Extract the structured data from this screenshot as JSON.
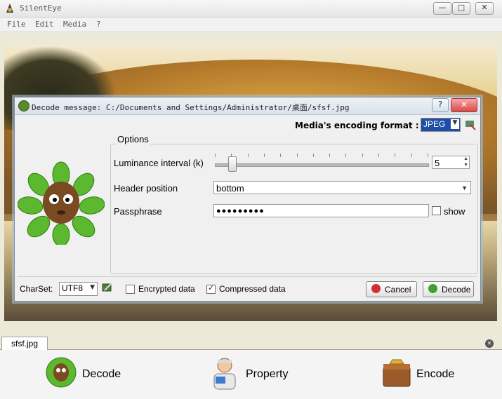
{
  "window": {
    "title": "SilentEye",
    "controls": [
      "▭",
      "□",
      "✕"
    ]
  },
  "menu": {
    "items": [
      "File",
      "Edit",
      "Media",
      "?"
    ]
  },
  "dialog": {
    "title": "Decode message: C:/Documents and Settings/Administrator/桌面/sfsf.jpg",
    "help_label": "?",
    "close_label": "✕",
    "encoding_label": "Media's encoding format :",
    "encoding_value": "JPEG",
    "options_title": "Options",
    "luminance_label": "Luminance interval (k)",
    "luminance_value": "5",
    "luminance_fraction": 0.08,
    "header_label": "Header position",
    "header_value": "bottom",
    "passphrase_label": "Passphrase",
    "passphrase_value": "●●●●●●●●●",
    "show_label": "show",
    "charset_label": "CharSet:",
    "charset_value": "UTF8",
    "encrypted_label": "Encrypted data",
    "encrypted_checked": false,
    "compressed_label": "Compressed data",
    "compressed_checked": true,
    "cancel_label": "Cancel",
    "decode_label": "Decode"
  },
  "tabs": {
    "active": "sfsf.jpg",
    "close_label": "✕"
  },
  "actions": {
    "decode_label": "Decode",
    "property_label": "Property",
    "encode_label": "Encode"
  },
  "colors": {
    "accent_green": "#3c9a1f",
    "cancel_red": "#d32f2f",
    "decode_green": "#3da32a"
  }
}
